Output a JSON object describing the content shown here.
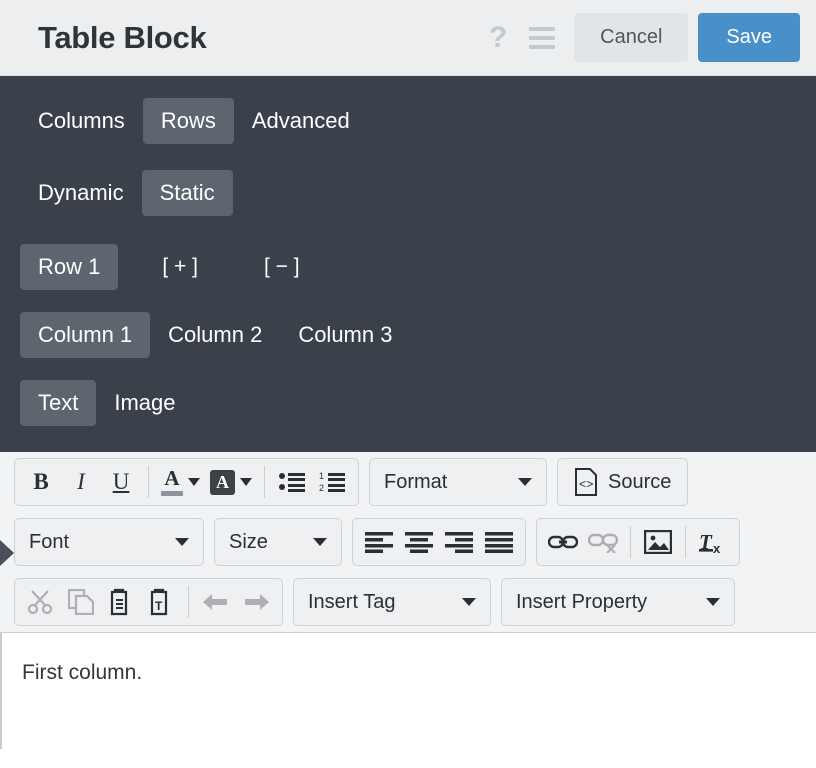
{
  "header": {
    "title": "Table Block",
    "help_icon": "question-mark-icon",
    "menu_icon": "hamburger-menu-icon",
    "cancel_label": "Cancel",
    "save_label": "Save",
    "save_color": "#4a90c8",
    "background": "#eceef0"
  },
  "panel": {
    "background": "#3a414a",
    "selected_background": "#5d656e",
    "mode_tabs": [
      {
        "label": "Columns",
        "selected": false
      },
      {
        "label": "Rows",
        "selected": true
      },
      {
        "label": "Advanced",
        "selected": false
      }
    ],
    "source_tabs": [
      {
        "label": "Dynamic",
        "selected": false
      },
      {
        "label": "Static",
        "selected": true
      }
    ],
    "rows": [
      {
        "label": "Row 1",
        "selected": true
      }
    ],
    "row_add_label": "[ + ]",
    "row_remove_label": "[ − ]",
    "columns": [
      {
        "label": "Column 1",
        "selected": true
      },
      {
        "label": "Column 2",
        "selected": false
      },
      {
        "label": "Column 3",
        "selected": false
      }
    ],
    "content_types": [
      {
        "label": "Text",
        "selected": true
      },
      {
        "label": "Image",
        "selected": false
      }
    ]
  },
  "editor": {
    "toolbar_row1": {
      "bold": "B",
      "italic": "I",
      "underline": "U",
      "text_color": "A",
      "bg_color": "A",
      "bullet_list_icon": "bulleted-list-icon",
      "numbered_list_icon": "numbered-list-icon",
      "format_label": "Format",
      "source_label": "Source"
    },
    "toolbar_row2": {
      "font_label": "Font",
      "size_label": "Size",
      "align_left_icon": "align-left-icon",
      "align_center_icon": "align-center-icon",
      "align_right_icon": "align-right-icon",
      "align_justify_icon": "align-justify-icon",
      "link_icon": "link-icon",
      "unlink_icon": "unlink-icon",
      "image_icon": "image-icon",
      "remove_format_icon": "remove-format-icon"
    },
    "toolbar_row3": {
      "cut_icon": "scissors-cut-icon",
      "copy_icon": "copy-icon",
      "paste_icon": "paste-clipboard-icon",
      "paste_text_icon": "paste-as-text-icon",
      "undo_icon": "undo-arrow-icon",
      "redo_icon": "redo-arrow-icon",
      "insert_tag_label": "Insert Tag",
      "insert_property_label": "Insert Property"
    },
    "collapse_arrow_icon": "collapse-panel-arrow-icon"
  },
  "content": {
    "text": "First column."
  }
}
